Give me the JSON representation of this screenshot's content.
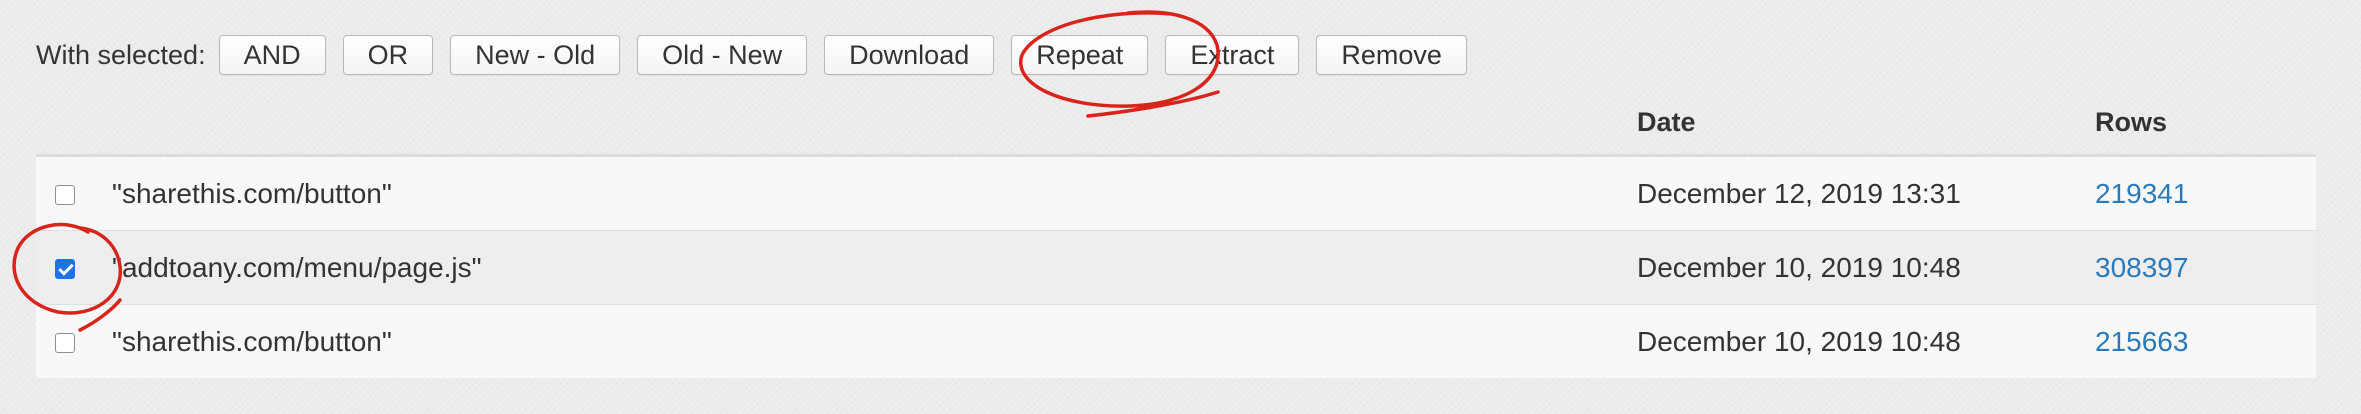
{
  "toolbar": {
    "label": "With selected:",
    "buttons": {
      "and": "AND",
      "or": "OR",
      "new_old": "New - Old",
      "old_new": "Old - New",
      "download": "Download",
      "repeat": "Repeat",
      "extract": "Extract",
      "remove": "Remove"
    }
  },
  "table": {
    "headers": {
      "query": "",
      "date": "Date",
      "rows": "Rows"
    },
    "rows": [
      {
        "checked": false,
        "query": "\"sharethis.com/button\"",
        "date": "December 12, 2019 13:31",
        "rows": "219341"
      },
      {
        "checked": true,
        "query": "\"addtoany.com/menu/page.js\"",
        "date": "December 10, 2019 10:48",
        "rows": "308397"
      },
      {
        "checked": false,
        "query": "\"sharethis.com/button\"",
        "date": "December 10, 2019 10:48",
        "rows": "215663"
      }
    ]
  },
  "colors": {
    "annotation": "#d9241c",
    "link": "#2a7ab9",
    "checkbox_checked": "#1a73e8"
  },
  "annotations": [
    {
      "kind": "hand-drawn-circle",
      "around": "repeat-button"
    },
    {
      "kind": "hand-drawn-circle",
      "around": "row-2-checkbox"
    }
  ]
}
